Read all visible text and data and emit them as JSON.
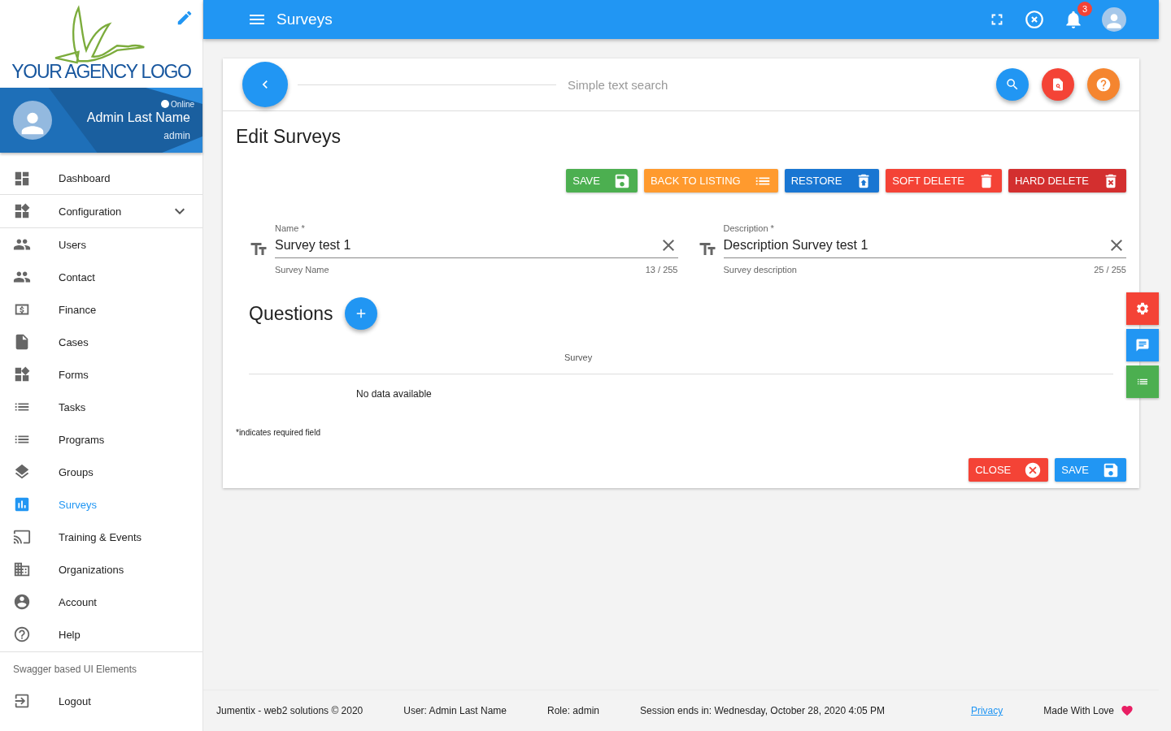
{
  "logo": {
    "text": "YOUR AGENCY LOGO"
  },
  "profile": {
    "status": "Online",
    "name": "Admin Last Name",
    "role": "admin"
  },
  "sidebar": {
    "items": [
      {
        "label": "Dashboard",
        "kind": "link",
        "selected": false
      },
      {
        "label": "Configuration",
        "kind": "group",
        "expanded": false,
        "selected": false
      },
      {
        "label": "Users",
        "kind": "link",
        "selected": false
      },
      {
        "label": "Contact",
        "kind": "link",
        "selected": false
      },
      {
        "label": "Finance",
        "kind": "link",
        "selected": false
      },
      {
        "label": "Cases",
        "kind": "link",
        "selected": false
      },
      {
        "label": "Forms",
        "kind": "link",
        "selected": false
      },
      {
        "label": "Tasks",
        "kind": "link",
        "selected": false
      },
      {
        "label": "Programs",
        "kind": "link",
        "selected": false
      },
      {
        "label": "Groups",
        "kind": "link",
        "selected": false
      },
      {
        "label": "Surveys",
        "kind": "link",
        "selected": true
      },
      {
        "label": "Training & Events",
        "kind": "link",
        "selected": false
      },
      {
        "label": "Organizations",
        "kind": "link",
        "selected": false
      },
      {
        "label": "Account",
        "kind": "link",
        "selected": false
      },
      {
        "label": "Help",
        "kind": "link",
        "selected": false
      }
    ],
    "section": "Swagger based UI Elements",
    "logout": "Logout"
  },
  "topbar": {
    "title": "Surveys",
    "notifications": "3"
  },
  "search": {
    "placeholder": "Simple text search"
  },
  "form": {
    "title": "Edit Surveys",
    "action_buttons": [
      {
        "label": "SAVE",
        "color": "#4caf50"
      },
      {
        "label": "BACK TO LISTING",
        "color": "#ff9a2e"
      },
      {
        "label": "RESTORE",
        "color": "#1976d2"
      },
      {
        "label": "SOFT DELETE",
        "color": "#f44336"
      },
      {
        "label": "HARD DELETE",
        "color": "#d32f2f"
      }
    ],
    "fields": [
      {
        "label": "Name *",
        "value": "Survey test 1",
        "hint": "Survey Name",
        "counter": "13 / 255"
      },
      {
        "label": "Description *",
        "value": "Description Survey test 1",
        "hint": "Survey description",
        "counter": "25 / 255"
      }
    ],
    "questions": {
      "title": "Questions",
      "columns": [
        "Survey"
      ],
      "empty": "No data available"
    },
    "required_note": "*indicates required field",
    "footer_buttons": [
      {
        "label": "CLOSE",
        "color": "#f44336"
      },
      {
        "label": "SAVE",
        "color": "#2196f3"
      }
    ]
  },
  "footer": {
    "items": [
      "Jumentix - web2 solutions © 2020",
      "User: Admin Last Name",
      "Role: admin",
      "Session ends in: Wednesday, October 28, 2020 4:05 PM"
    ],
    "link": "Privacy",
    "credit": "Made With Love"
  }
}
